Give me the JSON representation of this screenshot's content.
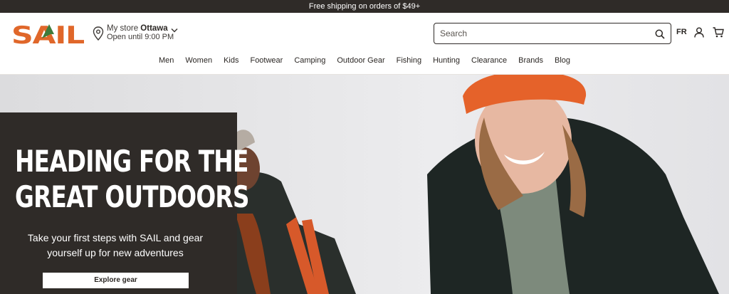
{
  "promo": {
    "text": "Free shipping on orders of $49+"
  },
  "header": {
    "logo_text": "SAIL",
    "store": {
      "prefix": "My store",
      "name": "Ottawa",
      "hours": "Open until 9:00 PM"
    },
    "search": {
      "placeholder": "Search",
      "value": ""
    },
    "lang_label": "FR",
    "icons": [
      "location-pin-icon",
      "chevron-down-icon",
      "search-icon",
      "account-icon",
      "cart-icon"
    ]
  },
  "nav": {
    "items": [
      "Men",
      "Women",
      "Kids",
      "Footwear",
      "Camping",
      "Outdoor Gear",
      "Fishing",
      "Hunting",
      "Clearance",
      "Brands",
      "Blog"
    ]
  },
  "hero": {
    "heading_line1": "HEADING FOR THE",
    "heading_line2": "GREAT OUTDOORS",
    "subtitle": "Take your first steps with SAIL and gear yourself up for new adventures",
    "cta_label": "Explore gear"
  },
  "colors": {
    "dark": "#2f2b28",
    "logo_orange": "#e0672a",
    "logo_green": "#3f7b3a",
    "beanie_orange": "#e5622a",
    "jacket": "#1e2624"
  }
}
